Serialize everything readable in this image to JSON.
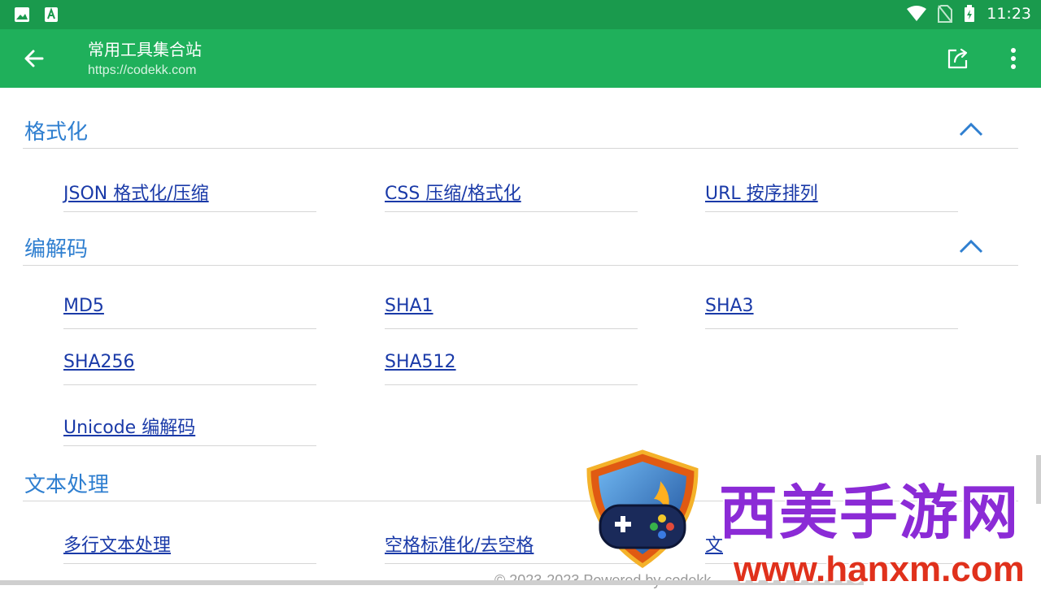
{
  "status": {
    "time": "11:23",
    "icons": [
      "image-icon",
      "font-a-icon",
      "wifi-icon",
      "no-sim-icon",
      "battery-charging-icon"
    ]
  },
  "app": {
    "title": "常用工具集合站",
    "url": "https://codekk.com"
  },
  "theme": {
    "status_bar": "#1a9a4d",
    "app_bar": "#1fb05b",
    "section_title": "#2f7fd0",
    "link": "#1a3aa8"
  },
  "sections": [
    {
      "title": "格式化",
      "links": [
        "JSON 格式化/压缩",
        "CSS 压缩/格式化",
        "URL 按序排列"
      ]
    },
    {
      "title": "编解码",
      "links": [
        "MD5",
        "SHA1",
        "SHA3",
        "SHA256",
        "SHA512",
        "Unicode 编解码"
      ]
    },
    {
      "title": "文本处理",
      "links": [
        "多行文本处理",
        "空格标准化/去空格",
        "文"
      ]
    }
  ],
  "footer": "© 2023-2023  Powered by codekk",
  "watermark": {
    "title": "西美手游网",
    "url": "www.hanxm.com"
  }
}
